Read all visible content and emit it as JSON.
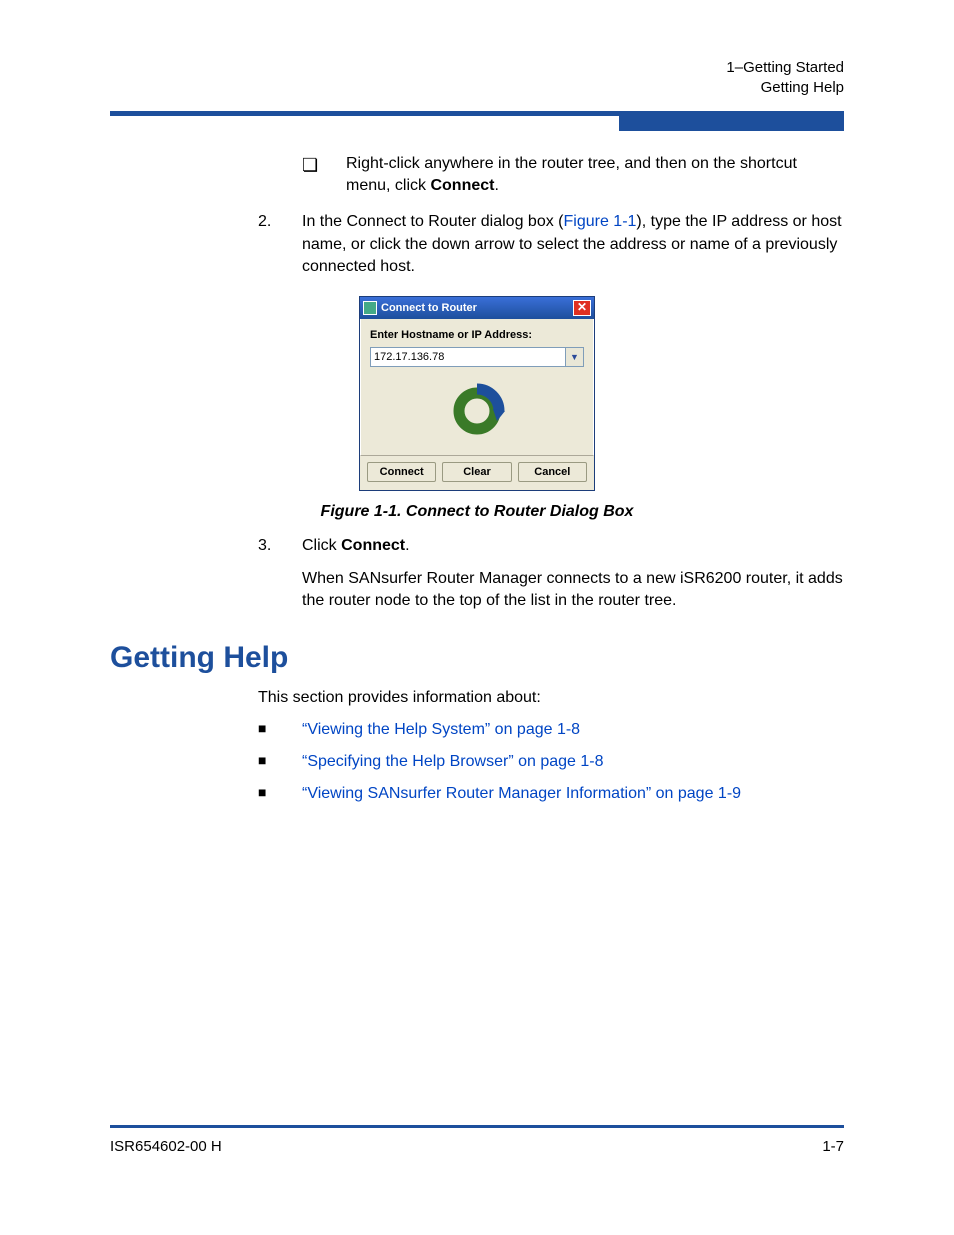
{
  "header": {
    "line1": "1–Getting Started",
    "line2": "Getting Help"
  },
  "steps": {
    "sub_bullet_text_before": "Right-click anywhere in the router tree, and then on the shortcut menu, click ",
    "sub_bullet_bold": "Connect",
    "sub_bullet_text_after": ".",
    "step2_num": "2.",
    "step2_before": "In the Connect to Router dialog box (",
    "step2_link": "Figure 1-1",
    "step2_after": "), type the IP address or host name, or click the down arrow to select the address or name of a previously connected host.",
    "step3_num": "3.",
    "step3_before": "Click ",
    "step3_bold": "Connect",
    "step3_after": ".",
    "step3_para": "When SANsurfer Router Manager connects to a new iSR6200 router, it adds the router node to the top of the list in the router tree."
  },
  "dialog": {
    "title": "Connect to Router",
    "field_label": "Enter Hostname or IP Address:",
    "ip_value": "172.17.136.78",
    "btn_connect": "Connect",
    "btn_clear": "Clear",
    "btn_cancel": "Cancel"
  },
  "figure_caption": "Figure 1-1. Connect to Router Dialog Box",
  "section_heading": "Getting Help",
  "intro": "This section provides information about:",
  "toc": [
    "“Viewing the Help System” on page 1-8",
    "“Specifying the Help Browser” on page 1-8",
    "“Viewing SANsurfer Router Manager Information” on page 1-9"
  ],
  "footer": {
    "left": "ISR654602-00  H",
    "right": "1-7"
  }
}
